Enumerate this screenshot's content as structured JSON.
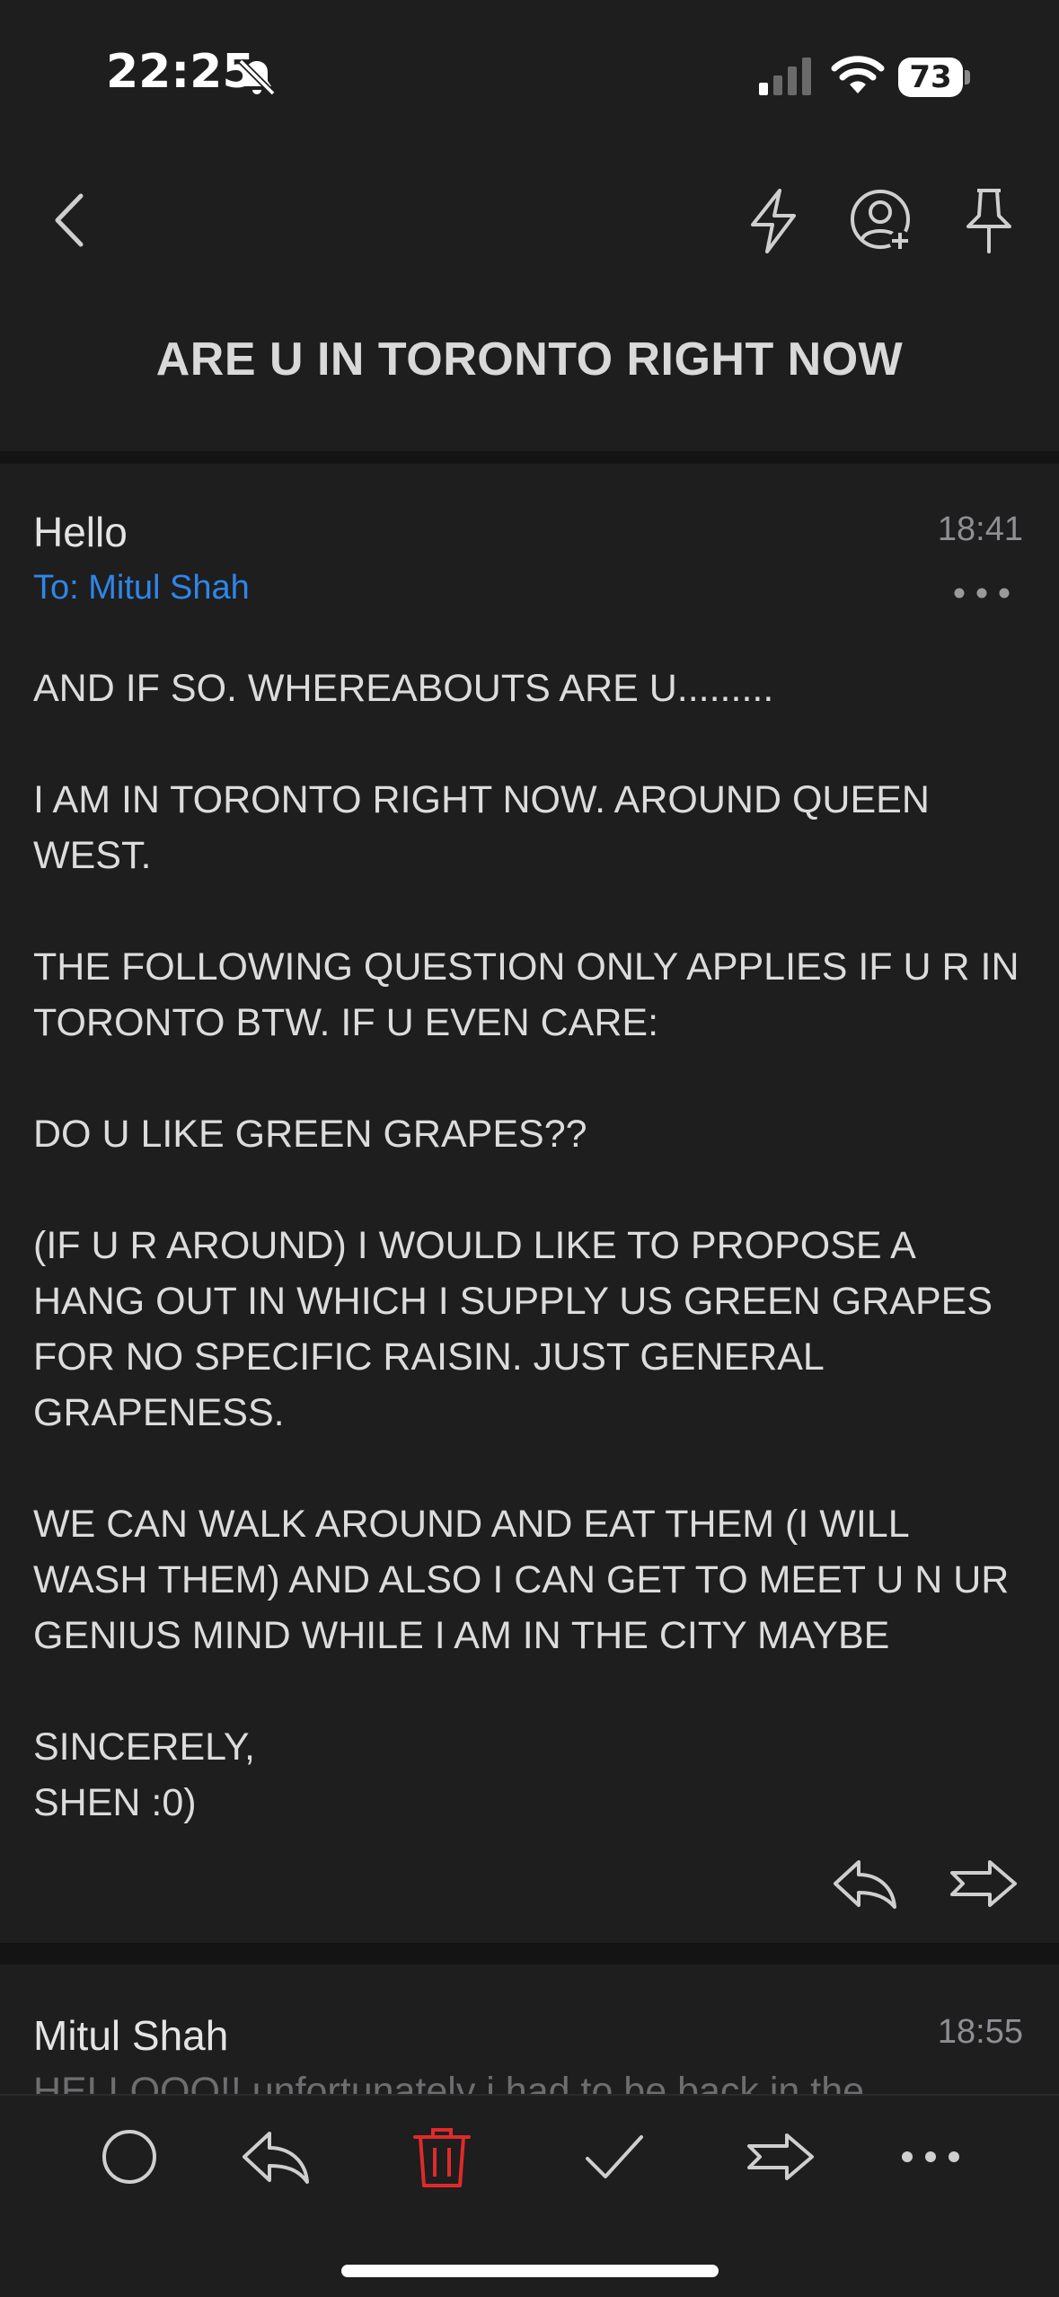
{
  "status_bar": {
    "time": "22:25",
    "battery": "73"
  },
  "nav": {
    "back_icon": "chevron-left-icon",
    "icons": [
      "bolt-icon",
      "add-contact-icon",
      "pin-icon"
    ]
  },
  "thread": {
    "subject": "ARE U IN TORONTO RIGHT NOW"
  },
  "message": {
    "from": "Hello",
    "time": "18:41",
    "to": "To: Mitul Shah",
    "body": [
      "AND IF SO. WHEREABOUTS ARE U.........",
      "I AM IN TORONTO RIGHT NOW. AROUND QUEEN WEST.",
      "THE FOLLOWING QUESTION ONLY APPLIES IF U R IN TORONTO BTW. IF U EVEN CARE:",
      "DO U LIKE GREEN GRAPES??",
      "(IF U R AROUND) I WOULD LIKE TO PROPOSE A HANG OUT IN WHICH I SUPPLY US GREEN GRAPES FOR NO SPECIFIC RAISIN. JUST GENERAL GRAPENESS.",
      "WE CAN WALK AROUND AND EAT THEM (I WILL WASH THEM) AND ALSO I CAN GET TO MEET U N UR GENIUS MIND WHILE I AM IN THE CITY MAYBE",
      "SINCERELY,\nSHEN :0)"
    ]
  },
  "message2": {
    "from": "Mitul Shah",
    "time": "18:55",
    "preview": "HELLOOO!! unfortunately i had to be back in the"
  },
  "toolbar": {
    "icons": [
      "circle-icon",
      "reply-icon",
      "trash-icon",
      "check-icon",
      "forward-icon",
      "more-icon"
    ],
    "trash_color": "#e02a2a"
  }
}
